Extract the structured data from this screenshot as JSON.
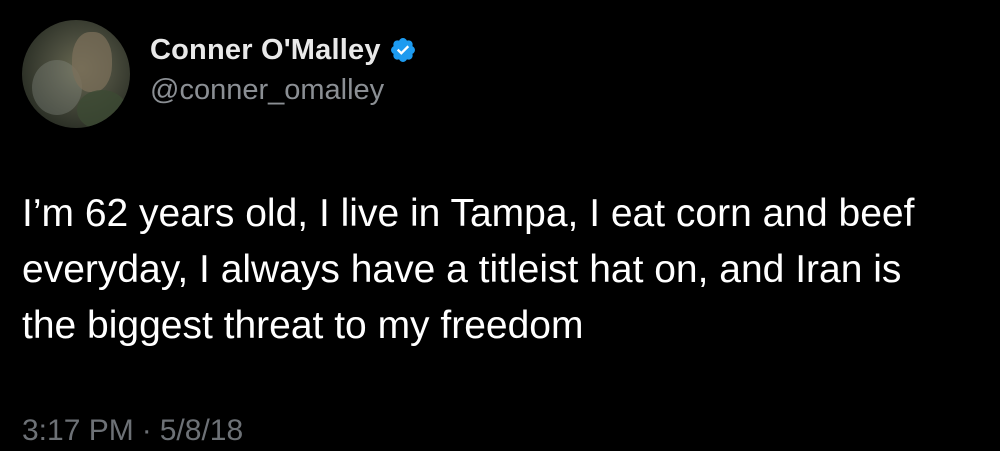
{
  "author": {
    "display_name": "Conner O'Malley",
    "handle": "@conner_omalley",
    "verified_badge_icon": "verified-badge-icon",
    "avatar_icon": "profile-photo"
  },
  "tweet": {
    "text_lines": [
      "I’m 62 years old, I live in Tampa, I eat corn and beef",
      "everyday, I always have a titleist hat on,  and Iran is",
      "the biggest threat to my freedom"
    ],
    "time": "3:17 PM",
    "separator": "·",
    "date": "5/8/18"
  },
  "colors": {
    "background": "#000000",
    "name": "#e9e9e9",
    "handle": "#8b8f94",
    "text": "#ffffff",
    "meta": "#6d7176",
    "verified": "#1d9bf0"
  }
}
